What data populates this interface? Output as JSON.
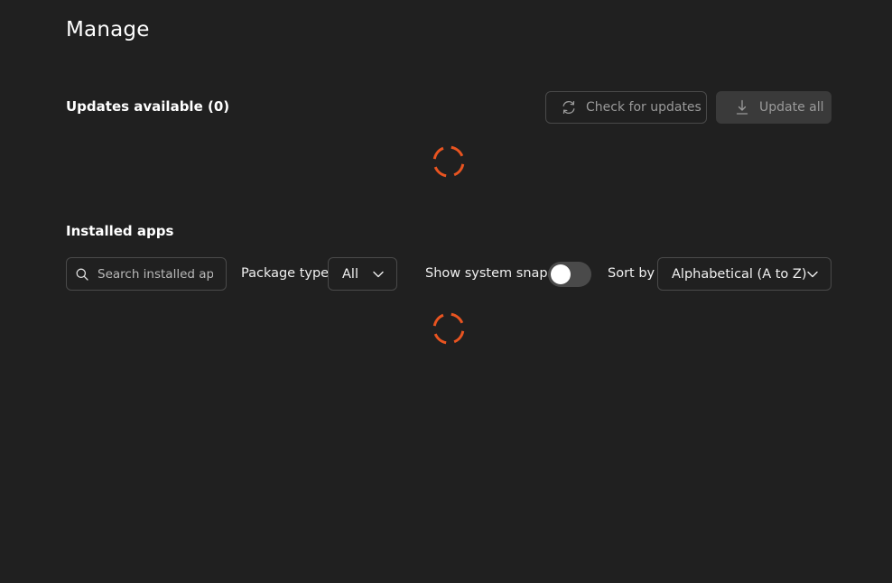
{
  "page": {
    "title": "Manage"
  },
  "updates": {
    "heading": "Updates available (0)",
    "check_button_label": "Check for updates",
    "update_all_label": "Update all",
    "check_icon": "refresh-icon",
    "update_icon": "download-icon",
    "loading": true
  },
  "installed": {
    "heading": "Installed apps",
    "search_placeholder": "Search installed apps",
    "package_type_label": "Package type",
    "package_type_value": "All",
    "show_system_snaps_label": "Show system snaps",
    "show_system_snaps_enabled": false,
    "sort_by_label": "Sort by",
    "sort_by_value": "Alphabetical (A to Z)",
    "loading": true
  },
  "colors": {
    "background": "#202020",
    "accent_spinner": "#E95420",
    "border": "#4a4a4a",
    "disabled_text": "#9a9a9a"
  }
}
